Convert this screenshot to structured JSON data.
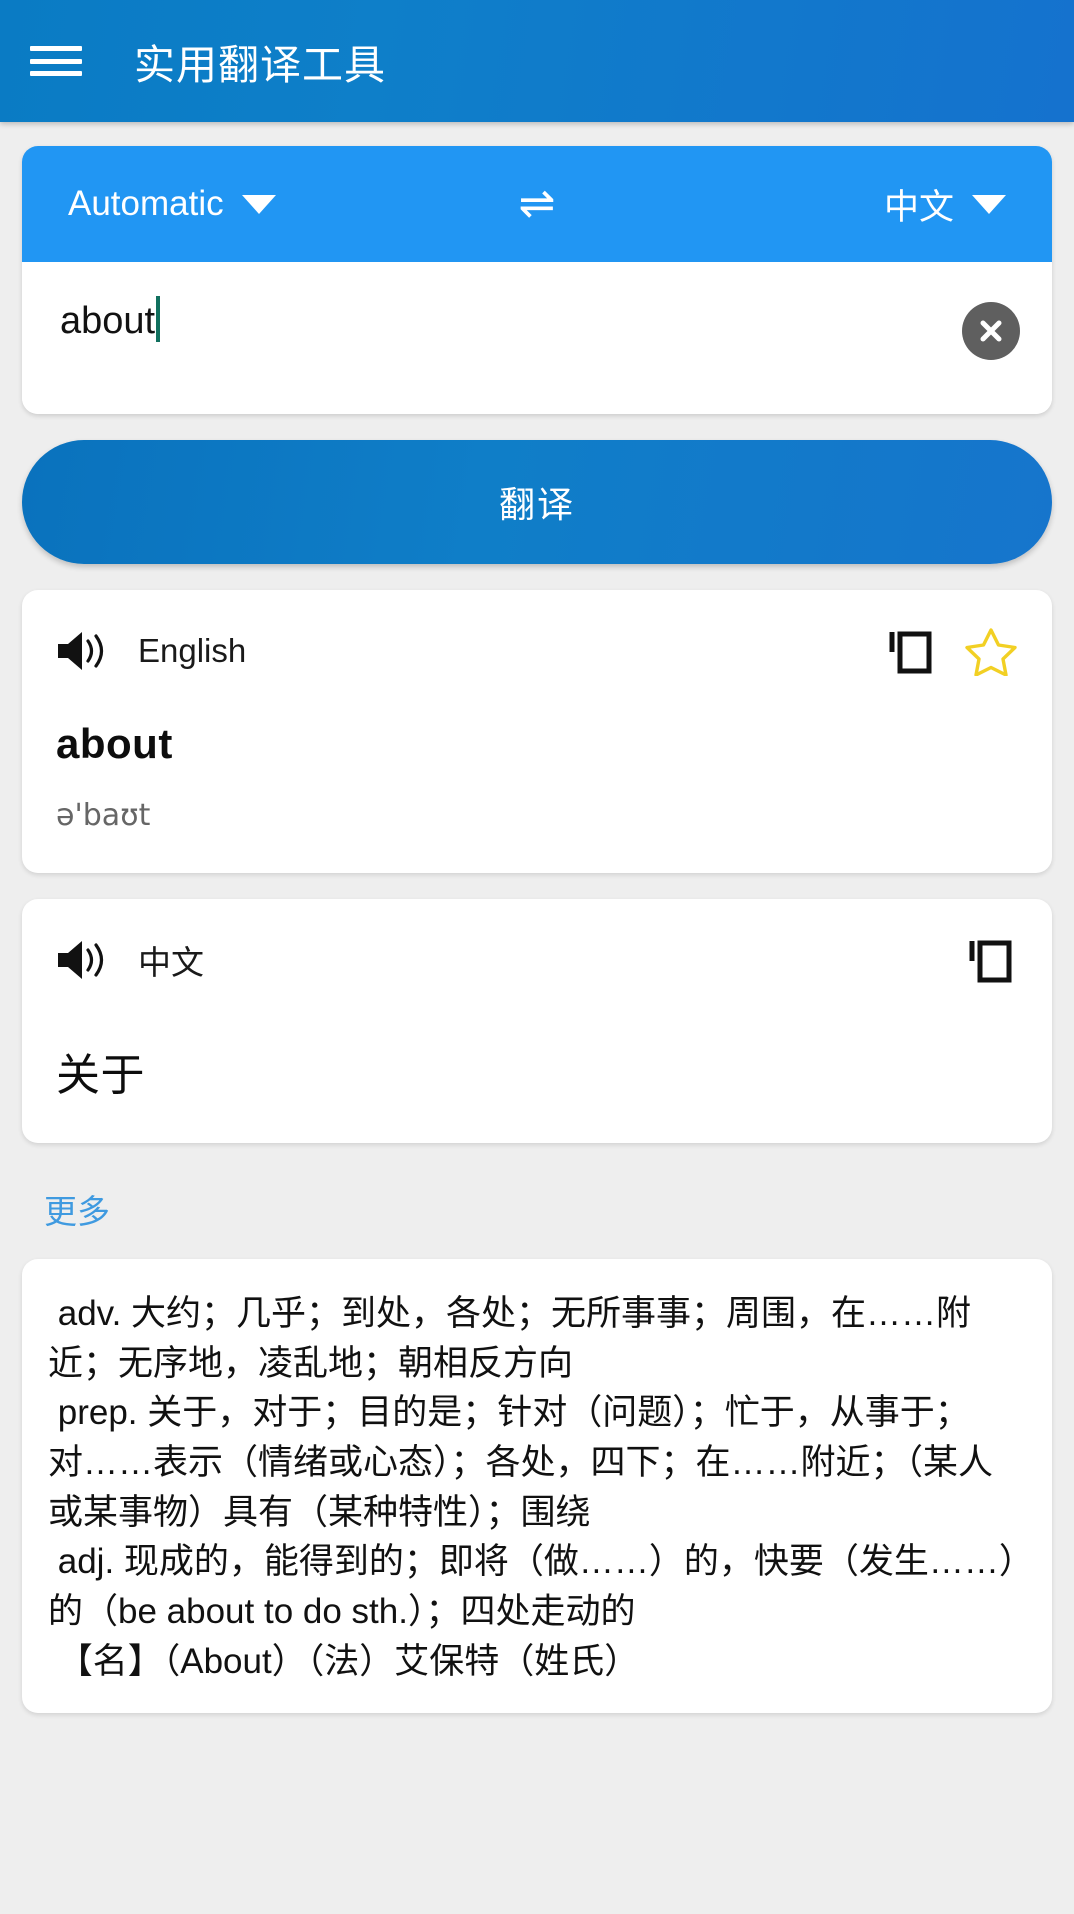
{
  "appbar": {
    "menu_icon": "hamburger-menu-icon",
    "title": "实用翻译工具"
  },
  "translator": {
    "source_lang": "Automatic",
    "target_lang": "中文",
    "swap_icon": "swap-horizontal-icon",
    "dropdown_icon": "chevron-down-icon",
    "input_value": "about",
    "input_placeholder": "",
    "clear_icon": "clear-circle-icon",
    "translate_label": "翻译"
  },
  "results": [
    {
      "speaker_icon": "speaker-icon",
      "lang": "English",
      "copy_icon": "copy-icon",
      "star_icon": "star-outline-icon",
      "word": "about",
      "phonetic": "ə'baʊt",
      "has_star": true
    },
    {
      "speaker_icon": "speaker-icon",
      "lang": "中文",
      "copy_icon": "copy-icon",
      "word": "关于",
      "phonetic": "",
      "has_star": false
    }
  ],
  "more": {
    "label": "更多"
  },
  "dictionary": {
    "text": " adv. 大约；几乎；到处，各处；无所事事；周围，在……附近；无序地，凌乱地；朝相反方向\n prep. 关于，对于；目的是；针对（问题）；忙于，从事于；对……表示（情绪或心态）；各处，四下；在……附近；（某人或某事物）具有（某种特性）；围绕\n adj. 现成的，能得到的；即将（做……）的，快要（发生……）的（be about to do sth.）；四处走动的\n 【名】（About）（法）艾保特（姓氏）"
  },
  "colors": {
    "appbar": "#0e7fc9",
    "lang_bar": "#2196f3",
    "accent": "#1675cc",
    "page_bg": "#eeeeee",
    "star": "#f2d024",
    "link": "#3f9ae0",
    "caret": "#11705e"
  }
}
